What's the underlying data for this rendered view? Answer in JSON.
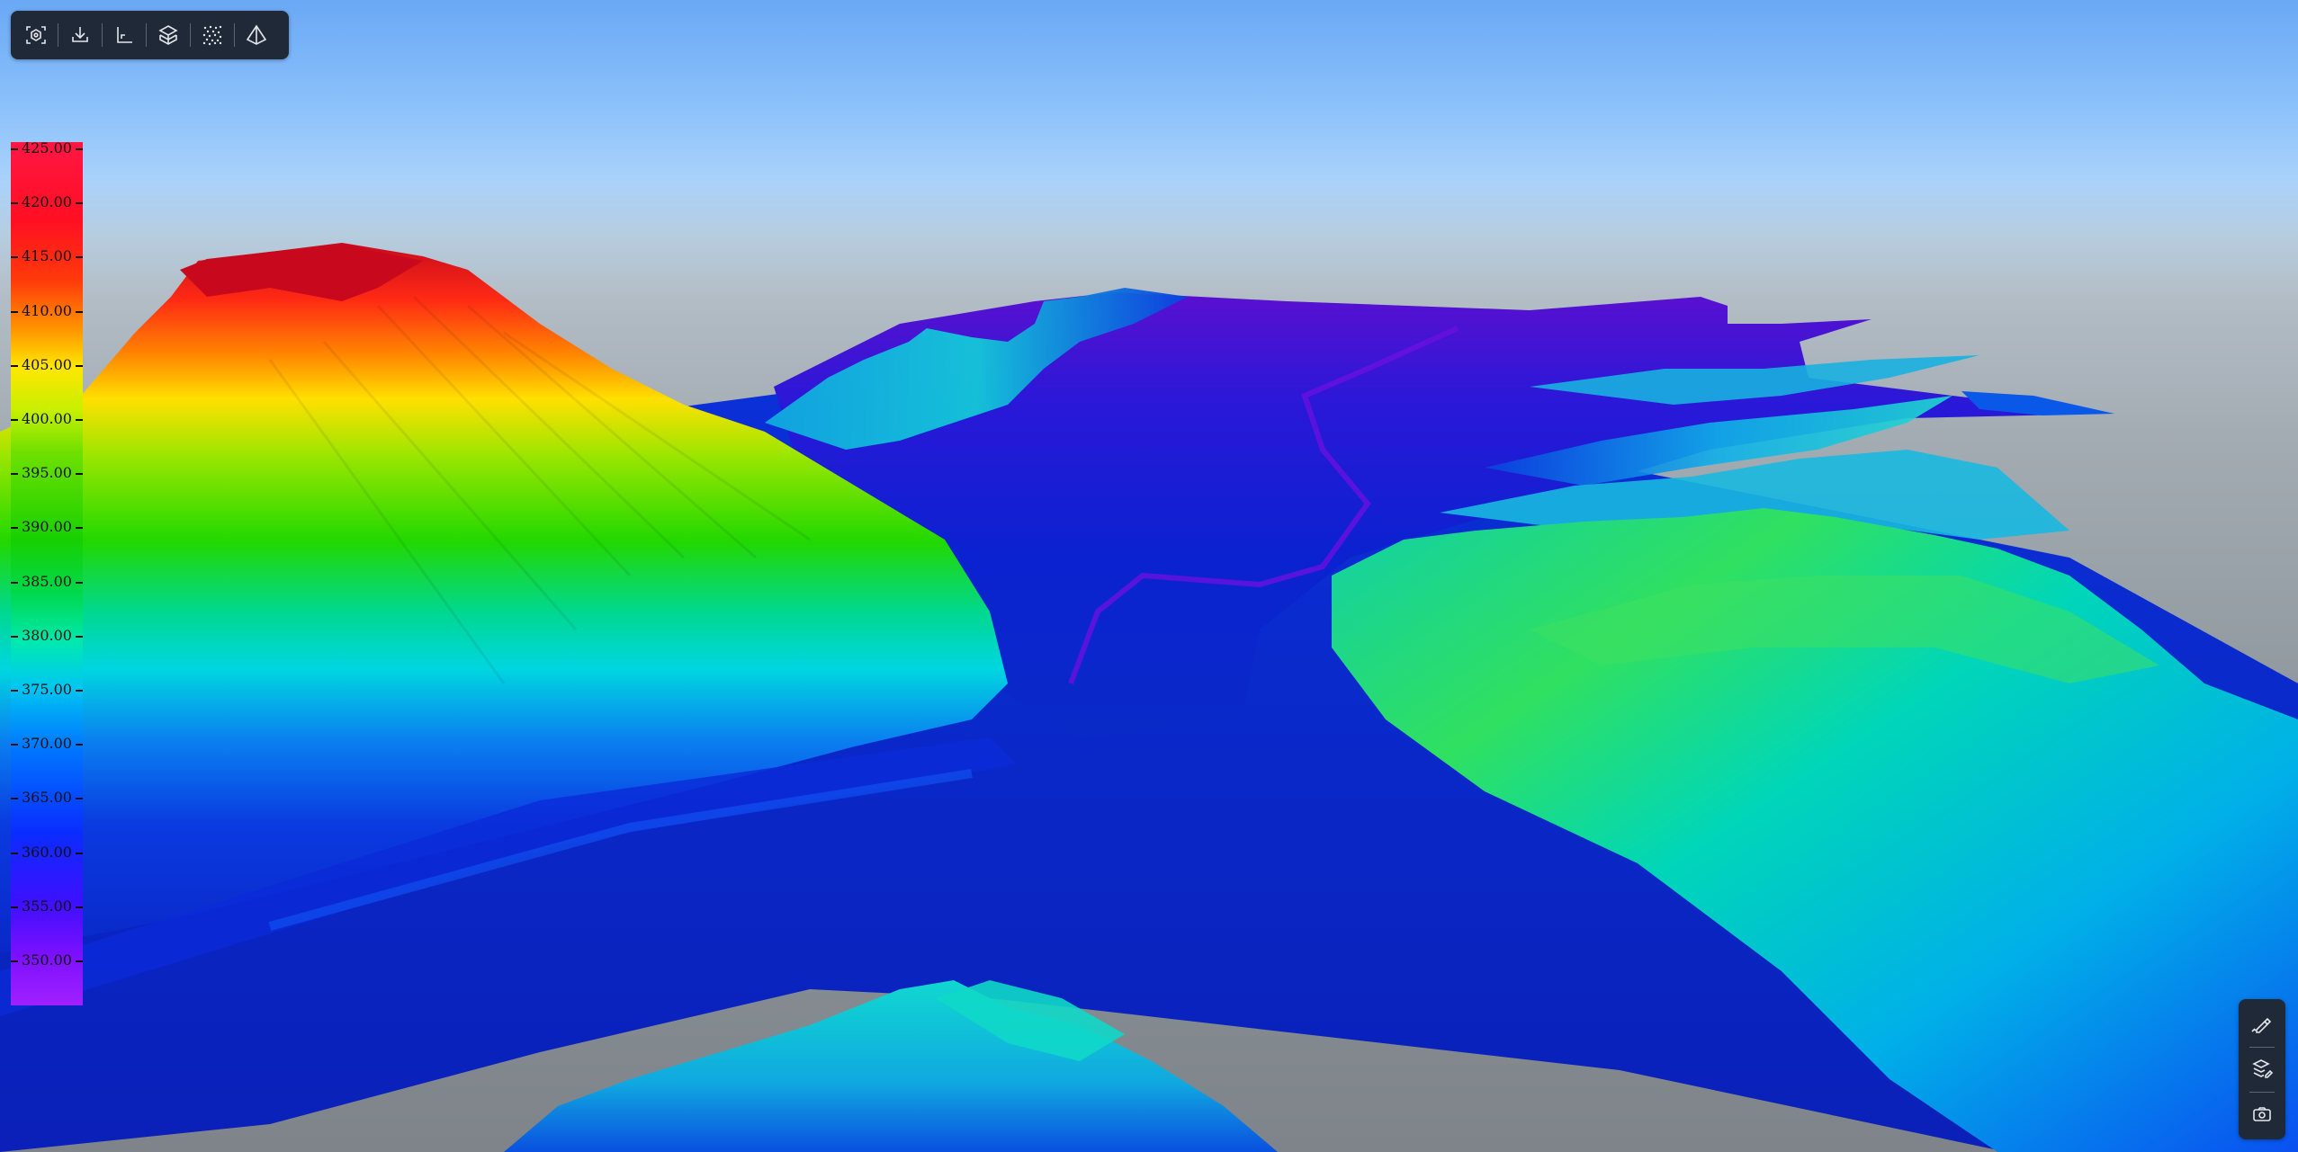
{
  "toolbar": {
    "buttons": [
      {
        "name": "focus-view",
        "icon": "camera-focus-icon"
      },
      {
        "name": "download",
        "icon": "download-icon"
      },
      {
        "name": "axes",
        "icon": "axes-icon"
      },
      {
        "name": "layers",
        "icon": "layers-icon"
      },
      {
        "name": "point-cloud",
        "icon": "point-cloud-icon"
      },
      {
        "name": "perspective",
        "icon": "pyramid-icon"
      }
    ]
  },
  "legend": {
    "labels": [
      "425.00",
      "420.00",
      "415.00",
      "410.00",
      "405.00",
      "400.00",
      "395.00",
      "390.00",
      "385.00",
      "380.00",
      "375.00",
      "370.00",
      "365.00",
      "360.00",
      "355.00",
      "350.00"
    ],
    "max": 425.0,
    "min": 345.0,
    "colors": {
      "top": "#ff1744",
      "bottom": "#a020ff"
    }
  },
  "side_panel": {
    "buttons": [
      {
        "name": "measure",
        "icon": "ruler-pen-icon"
      },
      {
        "name": "layer-edit",
        "icon": "layer-edit-icon"
      },
      {
        "name": "screenshot",
        "icon": "camera-icon"
      }
    ]
  },
  "colors": {
    "panel": "#1f2937",
    "icon": "#e5e7eb"
  }
}
